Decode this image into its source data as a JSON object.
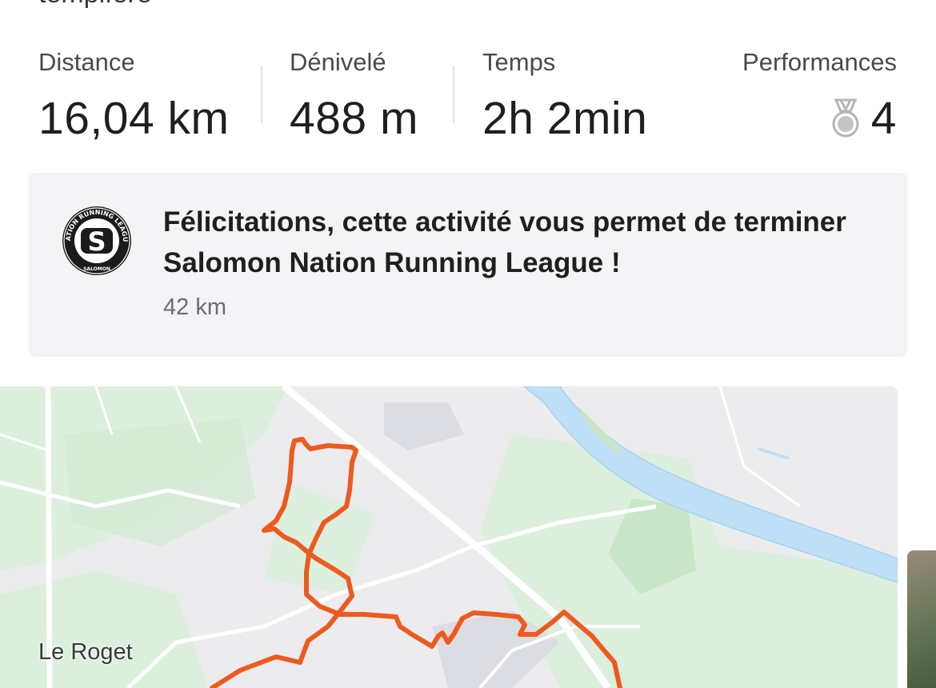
{
  "activity": {
    "title_fragment": "tempifere"
  },
  "stats": [
    {
      "label": "Distance",
      "value": "16,04 km"
    },
    {
      "label": "Dénivelé",
      "value": "488 m"
    },
    {
      "label": "Temps",
      "value": "2h 2min"
    }
  ],
  "performances": {
    "label": "Performances",
    "value": "4",
    "icon": "medal-icon"
  },
  "challenge": {
    "message": "Félicitations, cette activité vous permet de terminer Salomon Nation Running League !",
    "distance": "42 km",
    "badge_ring_text": "NATION RUNNING LEAGUE",
    "badge_brand": "SALOMON",
    "badge_letter": "S"
  },
  "map": {
    "place_label": "Le Roget",
    "route_color": "#ee5a1e",
    "river_color": "#bfe0f7",
    "green_color": "#dcefdc"
  }
}
